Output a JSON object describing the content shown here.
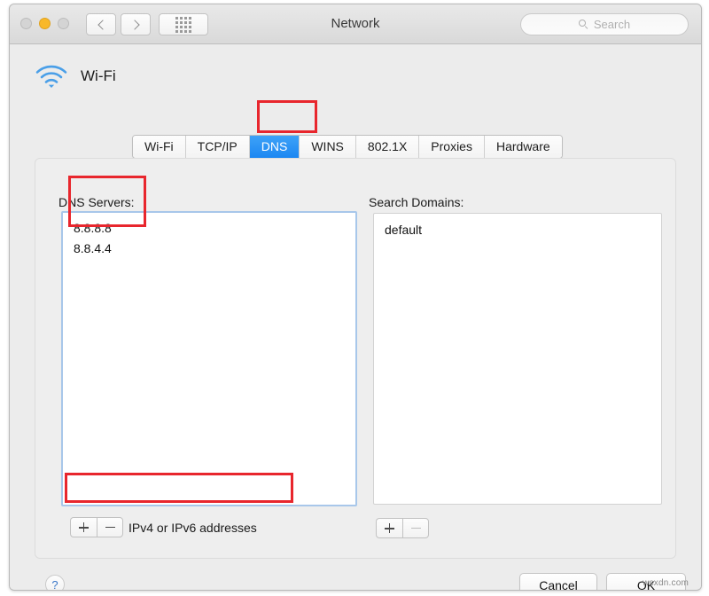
{
  "window": {
    "title": "Network",
    "traffic_lights": [
      "close",
      "minimize",
      "zoom"
    ],
    "nav_back_icon": "chevron-left-icon",
    "nav_forward_icon": "chevron-right-icon",
    "show_all_icon": "grid-icon",
    "search": {
      "placeholder": "Search",
      "icon": "search-icon"
    }
  },
  "service": {
    "name": "Wi-Fi",
    "icon": "wifi-icon"
  },
  "tabs": [
    {
      "label": "Wi-Fi",
      "selected": false
    },
    {
      "label": "TCP/IP",
      "selected": false
    },
    {
      "label": "DNS",
      "selected": true
    },
    {
      "label": "WINS",
      "selected": false
    },
    {
      "label": "802.1X",
      "selected": false
    },
    {
      "label": "Proxies",
      "selected": false
    },
    {
      "label": "Hardware",
      "selected": false
    }
  ],
  "dns_panel": {
    "servers_label": "DNS Servers:",
    "servers": [
      "8.8.8.8",
      "8.8.4.4"
    ],
    "search_domains_label": "Search Domains:",
    "search_domains": [
      "default"
    ],
    "add_icon": "plus-icon",
    "remove_icon": "minus-icon",
    "hint": "IPv4 or IPv6 addresses"
  },
  "footer": {
    "help_label": "?",
    "cancel_label": "Cancel",
    "ok_label": "OK"
  },
  "annotations": {
    "accent_color": "#e8262d",
    "boxes": [
      "dns-tab",
      "dns-servers-entries",
      "add-remove-row"
    ]
  },
  "watermark": "wsxdn.com",
  "colors": {
    "selected_tab": "#1c87f2",
    "focus_ring": "#a8c7ea",
    "window_bg": "#ececec",
    "help_glyph": "#3b78c8"
  }
}
